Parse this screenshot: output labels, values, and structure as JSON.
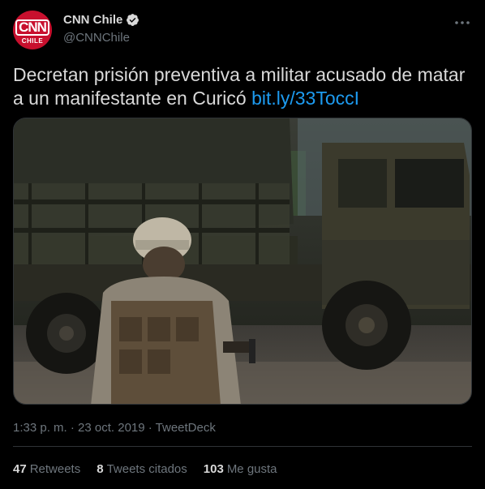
{
  "account": {
    "avatar_text": "CNN",
    "avatar_subtext": "CHILE",
    "display_name": "CNN Chile",
    "handle": "@CNNChile",
    "verified_icon": "verified-badge-icon"
  },
  "tweet": {
    "text": "Decretan prisión preventiva a militar acusado de matar a un manifestante en Curicó ",
    "link": "bit.ly/33ToccI",
    "timestamp": "1:33 p. m. · 23 oct. 2019 · TweetDeck"
  },
  "stats": {
    "retweets_count": "47",
    "retweets_label": "Retweets",
    "quotes_count": "8",
    "quotes_label": "Tweets citados",
    "likes_count": "103",
    "likes_label": "Me gusta"
  },
  "colors": {
    "background": "#000000",
    "text": "#d9d9d9",
    "secondary": "#6e767d",
    "link": "#1d9bf0",
    "brand": "#c8102e"
  }
}
